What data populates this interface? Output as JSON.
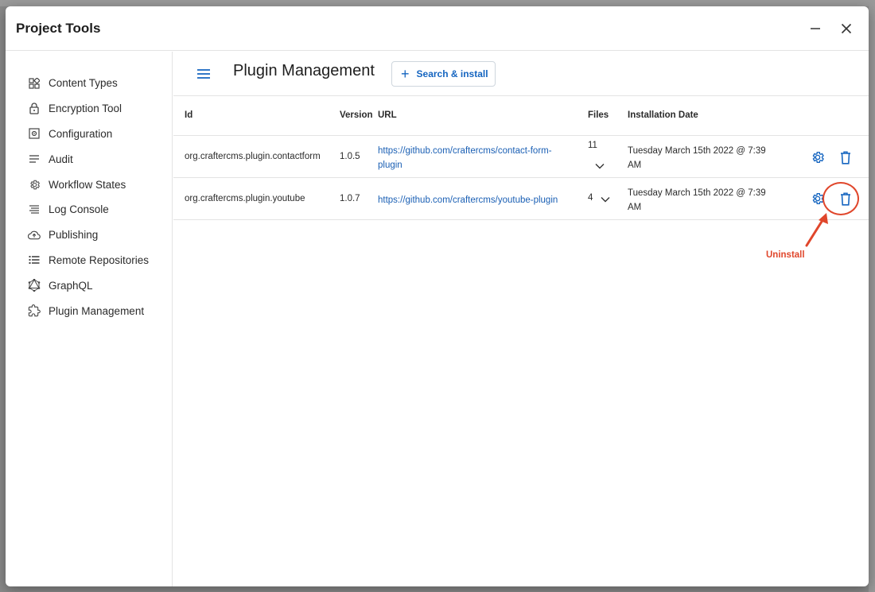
{
  "dialog": {
    "title": "Project Tools"
  },
  "sidebar": {
    "items": [
      {
        "label": "Content Types",
        "icon": "content-types-icon"
      },
      {
        "label": "Encryption Tool",
        "icon": "lock-icon"
      },
      {
        "label": "Configuration",
        "icon": "configuration-icon"
      },
      {
        "label": "Audit",
        "icon": "audit-icon"
      },
      {
        "label": "Workflow States",
        "icon": "gear-icon"
      },
      {
        "label": "Log Console",
        "icon": "log-console-icon"
      },
      {
        "label": "Publishing",
        "icon": "cloud-upload-icon"
      },
      {
        "label": "Remote Repositories",
        "icon": "list-icon"
      },
      {
        "label": "GraphQL",
        "icon": "graphql-icon"
      },
      {
        "label": "Plugin Management",
        "icon": "puzzle-icon"
      }
    ]
  },
  "main": {
    "title": "Plugin Management",
    "search_install_label": "Search & install",
    "columns": [
      "Id",
      "Version",
      "URL",
      "Files",
      "Installation Date"
    ],
    "rows": [
      {
        "id": "org.craftercms.plugin.contactform",
        "version": "1.0.5",
        "url_line1": "https://github.com/craftercms/contact-form-",
        "url_line2": "plugin",
        "files": "11",
        "date_line1": "Tuesday March 15th 2022 @ 7:39",
        "date_line2": "AM"
      },
      {
        "id": "org.craftercms.plugin.youtube",
        "version": "1.0.7",
        "url_line1": "https://github.com/craftercms/youtube-plugin",
        "url_line2": "",
        "files": "4",
        "date_line1": "Tuesday March 15th 2022 @ 7:39",
        "date_line2": "AM"
      }
    ]
  },
  "annotation": {
    "label": "Uninstall",
    "color": "#e0462b"
  },
  "colors": {
    "accent": "#1565c0",
    "link": "#1a5fb4"
  }
}
